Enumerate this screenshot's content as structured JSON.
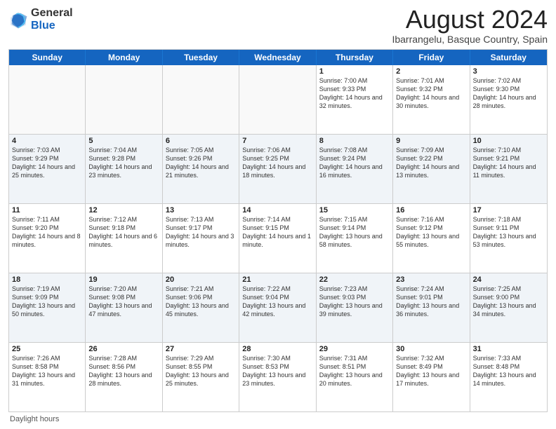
{
  "header": {
    "logo_general": "General",
    "logo_blue": "Blue",
    "month_title": "August 2024",
    "location": "Ibarrangelu, Basque Country, Spain"
  },
  "calendar": {
    "days_of_week": [
      "Sunday",
      "Monday",
      "Tuesday",
      "Wednesday",
      "Thursday",
      "Friday",
      "Saturday"
    ],
    "rows": [
      {
        "alt": false,
        "cells": [
          {
            "day": "",
            "text": "",
            "empty": true
          },
          {
            "day": "",
            "text": "",
            "empty": true
          },
          {
            "day": "",
            "text": "",
            "empty": true
          },
          {
            "day": "",
            "text": "",
            "empty": true
          },
          {
            "day": "1",
            "text": "Sunrise: 7:00 AM\nSunset: 9:33 PM\nDaylight: 14 hours\nand 32 minutes.",
            "empty": false
          },
          {
            "day": "2",
            "text": "Sunrise: 7:01 AM\nSunset: 9:32 PM\nDaylight: 14 hours\nand 30 minutes.",
            "empty": false
          },
          {
            "day": "3",
            "text": "Sunrise: 7:02 AM\nSunset: 9:30 PM\nDaylight: 14 hours\nand 28 minutes.",
            "empty": false
          }
        ]
      },
      {
        "alt": true,
        "cells": [
          {
            "day": "4",
            "text": "Sunrise: 7:03 AM\nSunset: 9:29 PM\nDaylight: 14 hours\nand 25 minutes.",
            "empty": false
          },
          {
            "day": "5",
            "text": "Sunrise: 7:04 AM\nSunset: 9:28 PM\nDaylight: 14 hours\nand 23 minutes.",
            "empty": false
          },
          {
            "day": "6",
            "text": "Sunrise: 7:05 AM\nSunset: 9:26 PM\nDaylight: 14 hours\nand 21 minutes.",
            "empty": false
          },
          {
            "day": "7",
            "text": "Sunrise: 7:06 AM\nSunset: 9:25 PM\nDaylight: 14 hours\nand 18 minutes.",
            "empty": false
          },
          {
            "day": "8",
            "text": "Sunrise: 7:08 AM\nSunset: 9:24 PM\nDaylight: 14 hours\nand 16 minutes.",
            "empty": false
          },
          {
            "day": "9",
            "text": "Sunrise: 7:09 AM\nSunset: 9:22 PM\nDaylight: 14 hours\nand 13 minutes.",
            "empty": false
          },
          {
            "day": "10",
            "text": "Sunrise: 7:10 AM\nSunset: 9:21 PM\nDaylight: 14 hours\nand 11 minutes.",
            "empty": false
          }
        ]
      },
      {
        "alt": false,
        "cells": [
          {
            "day": "11",
            "text": "Sunrise: 7:11 AM\nSunset: 9:20 PM\nDaylight: 14 hours\nand 8 minutes.",
            "empty": false
          },
          {
            "day": "12",
            "text": "Sunrise: 7:12 AM\nSunset: 9:18 PM\nDaylight: 14 hours\nand 6 minutes.",
            "empty": false
          },
          {
            "day": "13",
            "text": "Sunrise: 7:13 AM\nSunset: 9:17 PM\nDaylight: 14 hours\nand 3 minutes.",
            "empty": false
          },
          {
            "day": "14",
            "text": "Sunrise: 7:14 AM\nSunset: 9:15 PM\nDaylight: 14 hours\nand 1 minute.",
            "empty": false
          },
          {
            "day": "15",
            "text": "Sunrise: 7:15 AM\nSunset: 9:14 PM\nDaylight: 13 hours\nand 58 minutes.",
            "empty": false
          },
          {
            "day": "16",
            "text": "Sunrise: 7:16 AM\nSunset: 9:12 PM\nDaylight: 13 hours\nand 55 minutes.",
            "empty": false
          },
          {
            "day": "17",
            "text": "Sunrise: 7:18 AM\nSunset: 9:11 PM\nDaylight: 13 hours\nand 53 minutes.",
            "empty": false
          }
        ]
      },
      {
        "alt": true,
        "cells": [
          {
            "day": "18",
            "text": "Sunrise: 7:19 AM\nSunset: 9:09 PM\nDaylight: 13 hours\nand 50 minutes.",
            "empty": false
          },
          {
            "day": "19",
            "text": "Sunrise: 7:20 AM\nSunset: 9:08 PM\nDaylight: 13 hours\nand 47 minutes.",
            "empty": false
          },
          {
            "day": "20",
            "text": "Sunrise: 7:21 AM\nSunset: 9:06 PM\nDaylight: 13 hours\nand 45 minutes.",
            "empty": false
          },
          {
            "day": "21",
            "text": "Sunrise: 7:22 AM\nSunset: 9:04 PM\nDaylight: 13 hours\nand 42 minutes.",
            "empty": false
          },
          {
            "day": "22",
            "text": "Sunrise: 7:23 AM\nSunset: 9:03 PM\nDaylight: 13 hours\nand 39 minutes.",
            "empty": false
          },
          {
            "day": "23",
            "text": "Sunrise: 7:24 AM\nSunset: 9:01 PM\nDaylight: 13 hours\nand 36 minutes.",
            "empty": false
          },
          {
            "day": "24",
            "text": "Sunrise: 7:25 AM\nSunset: 9:00 PM\nDaylight: 13 hours\nand 34 minutes.",
            "empty": false
          }
        ]
      },
      {
        "alt": false,
        "cells": [
          {
            "day": "25",
            "text": "Sunrise: 7:26 AM\nSunset: 8:58 PM\nDaylight: 13 hours\nand 31 minutes.",
            "empty": false
          },
          {
            "day": "26",
            "text": "Sunrise: 7:28 AM\nSunset: 8:56 PM\nDaylight: 13 hours\nand 28 minutes.",
            "empty": false
          },
          {
            "day": "27",
            "text": "Sunrise: 7:29 AM\nSunset: 8:55 PM\nDaylight: 13 hours\nand 25 minutes.",
            "empty": false
          },
          {
            "day": "28",
            "text": "Sunrise: 7:30 AM\nSunset: 8:53 PM\nDaylight: 13 hours\nand 23 minutes.",
            "empty": false
          },
          {
            "day": "29",
            "text": "Sunrise: 7:31 AM\nSunset: 8:51 PM\nDaylight: 13 hours\nand 20 minutes.",
            "empty": false
          },
          {
            "day": "30",
            "text": "Sunrise: 7:32 AM\nSunset: 8:49 PM\nDaylight: 13 hours\nand 17 minutes.",
            "empty": false
          },
          {
            "day": "31",
            "text": "Sunrise: 7:33 AM\nSunset: 8:48 PM\nDaylight: 13 hours\nand 14 minutes.",
            "empty": false
          }
        ]
      }
    ]
  },
  "footer": {
    "note": "Daylight hours"
  }
}
